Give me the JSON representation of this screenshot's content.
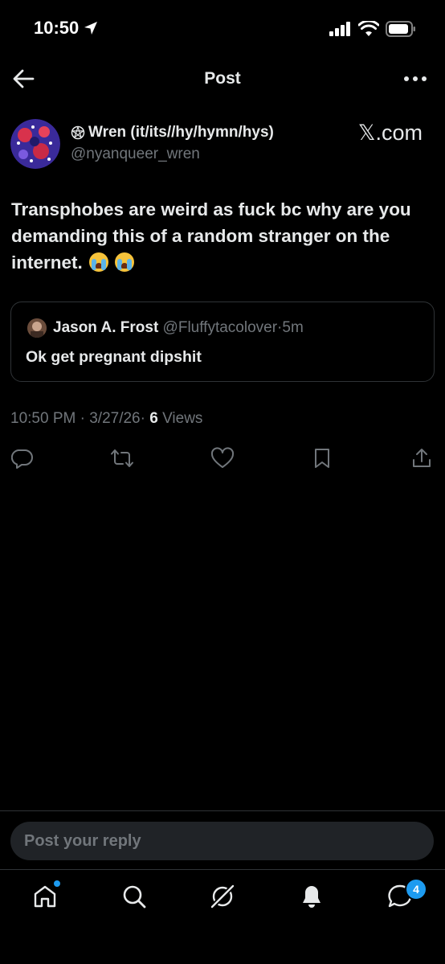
{
  "status_bar": {
    "time": "10:50"
  },
  "nav": {
    "title": "Post"
  },
  "post": {
    "author_name": "Wren (it/its//hy/hymn/hys)",
    "author_handle": "@nyanqueer_wren",
    "source": "𝕏.com",
    "text": "Transphobes are weird as fuck bc why are you demanding this of a random stranger on the internet.",
    "emojis": [
      "loudly-crying-face",
      "loudly-crying-face"
    ],
    "quote": {
      "author_name": "Jason A. Frost",
      "author_handle": "@Fluffytacolover",
      "separator": "·",
      "time": "5m",
      "text": "Ok get pregnant dipshit"
    },
    "meta": {
      "time": "10:50 PM",
      "date": "3/27/26",
      "separator": "·",
      "views_count": "6",
      "views_label": "Views"
    }
  },
  "reply": {
    "placeholder": "Post your reply"
  },
  "tabs": {
    "items": [
      "home",
      "search",
      "grok",
      "notifications",
      "messages"
    ],
    "messages_badge": "4"
  },
  "colors": {
    "background": "#000000",
    "text": "#e7e9ea",
    "muted": "#71767b",
    "accent": "#1d9bf0",
    "border": "#2f3336"
  }
}
